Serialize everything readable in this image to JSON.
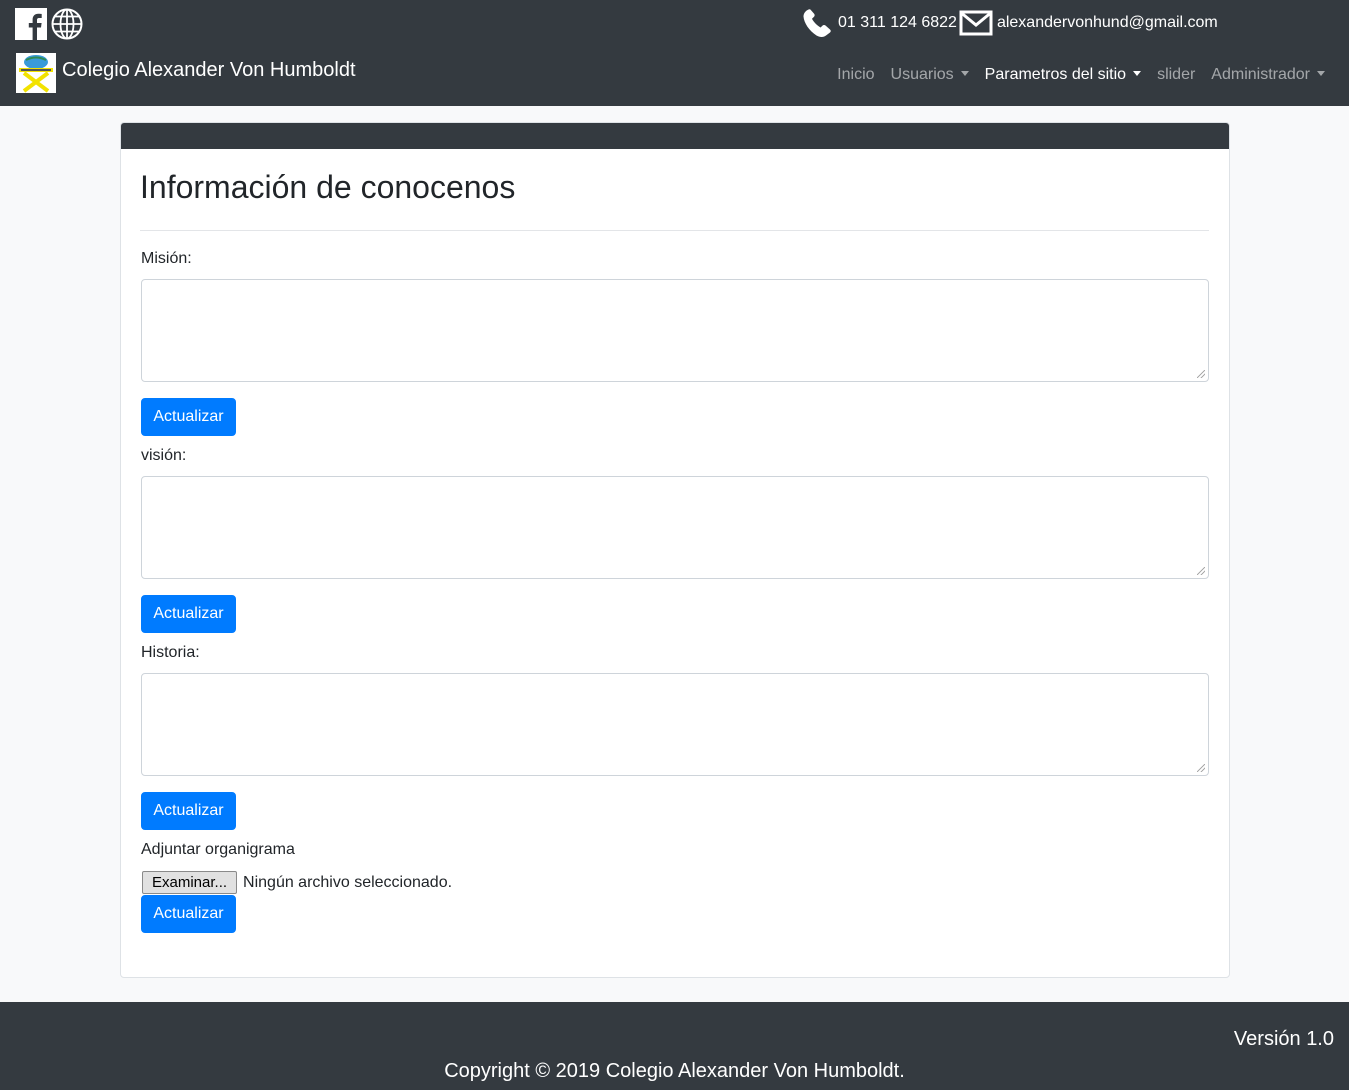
{
  "header": {
    "phone": "01 311 124 6822",
    "email": "alexandervonhund@gmail.com",
    "brand_name": "Colegio Alexander Von Humboldt",
    "social_icons": [
      "facebook-icon",
      "globe-icon"
    ],
    "nav": {
      "inicio": "Inicio",
      "usuarios": "Usuarios",
      "parametros": "Parametros del sitio",
      "slider": "slider",
      "administrador": "Administrador"
    }
  },
  "main": {
    "title": "Información de conocenos",
    "mision_label": "Misión:",
    "vision_label": "visión:",
    "historia_label": "Historia:",
    "update_label": "Actualizar",
    "organigrama_label": "Adjuntar organigrama",
    "file_button": "Examinar...",
    "file_status": "Ningún archivo seleccionado."
  },
  "footer": {
    "version": "Versión 1.0",
    "copyright": "Copyright © 2019 Colegio Alexander Von Humboldt."
  },
  "colors": {
    "navbar": "#343a40",
    "primary": "#007bff",
    "page_bg": "#f8f9fa"
  }
}
